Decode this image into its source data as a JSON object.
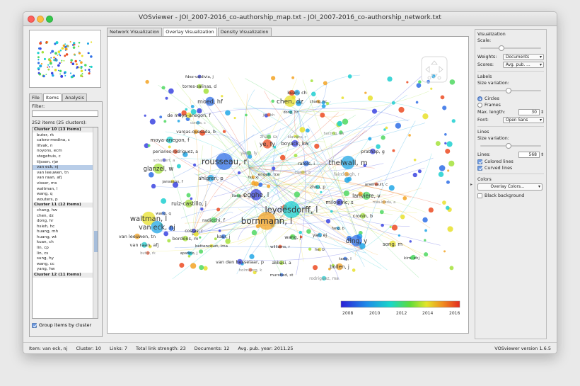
{
  "window": {
    "title": "VOSviewer - JOI_2007-2016_co-authorship_map.txt - JOI_2007-2016_co-authorship_network.txt"
  },
  "left": {
    "tabs": [
      "File",
      "Items",
      "Analysis"
    ],
    "filter_label": "Filter:",
    "items_count": "252 items (25 clusters):",
    "list": [
      {
        "text": "Cluster 10 (13 items)",
        "header": true
      },
      {
        "text": "buter, rk"
      },
      {
        "text": "calero-medina, c"
      },
      {
        "text": "litvak, n"
      },
      {
        "text": "noyons, ecm"
      },
      {
        "text": "stegehuis, c"
      },
      {
        "text": "tijssen, rjw"
      },
      {
        "text": "van eck, nj",
        "selected": true
      },
      {
        "text": "van leeuwen, tn"
      },
      {
        "text": "van raan, afj"
      },
      {
        "text": "visser, ms"
      },
      {
        "text": "waltman, l"
      },
      {
        "text": "wang, q"
      },
      {
        "text": "wouters, p"
      },
      {
        "text": "Cluster 11 (12 items)",
        "header": true
      },
      {
        "text": "chang, hw"
      },
      {
        "text": "chen, dz"
      },
      {
        "text": "dong, hr"
      },
      {
        "text": "hsieh, hc"
      },
      {
        "text": "huang, mh"
      },
      {
        "text": "huang, wt"
      },
      {
        "text": "kuan, ch"
      },
      {
        "text": "lin, cp"
      },
      {
        "text": "lin, cs"
      },
      {
        "text": "sung, hy"
      },
      {
        "text": "wang, cc"
      },
      {
        "text": "yang, hw"
      },
      {
        "text": "Cluster 12 (11 items)",
        "header": true
      }
    ],
    "group_label": "Group items by cluster"
  },
  "center": {
    "tabs": [
      "Network Visualization",
      "Overlay Visualization",
      "Density Visualization"
    ],
    "legend": {
      "ticks": [
        "2008",
        "2010",
        "2012",
        "2014",
        "2016"
      ]
    },
    "labels": [
      {
        "t": "fdez-valdivia, j",
        "s": 5.5,
        "c": "#333"
      },
      {
        "t": "torres-salinas, d",
        "s": 6,
        "c": "#333"
      },
      {
        "t": "moed, hf",
        "s": 8,
        "c": "#333"
      },
      {
        "t": "de moya-anegon, f",
        "s": 6.5,
        "c": "#333"
      },
      {
        "t": "corera, c",
        "s": 5,
        "c": "#888"
      },
      {
        "t": "vargas-quesada, b",
        "s": 6,
        "c": "#333"
      },
      {
        "t": "moya-anegon, f",
        "s": 7,
        "c": "#333"
      },
      {
        "t": "perianes-rodriguez, a",
        "s": 6,
        "c": "#333"
      },
      {
        "t": "yang, ly",
        "s": 6,
        "c": "#888"
      },
      {
        "t": "schubert, a",
        "s": 5.5,
        "c": "#888"
      },
      {
        "t": "glanzel, w",
        "s": 8.5,
        "c": "#333"
      },
      {
        "t": "rousseau, r",
        "s": 11.5,
        "c": "#333"
      },
      {
        "t": "janssens, f",
        "s": 5.5,
        "c": "#333"
      },
      {
        "t": "ahlgren, p",
        "s": 7,
        "c": "#333"
      },
      {
        "t": "hu, xj",
        "s": 5.5,
        "c": "#333"
      },
      {
        "t": "engels, tce",
        "s": 5.5,
        "c": "#333"
      },
      {
        "t": "jin, bh",
        "s": 5.5,
        "c": "#888"
      },
      {
        "t": "liang, l",
        "s": 5.5,
        "c": "#333"
      },
      {
        "t": "egghe, l",
        "s": 9,
        "c": "#333"
      },
      {
        "t": "ruiz-castillo, j",
        "s": 7.5,
        "c": "#333"
      },
      {
        "t": "wang, q",
        "s": 5.5,
        "c": "#333"
      },
      {
        "t": "waltman, l",
        "s": 10,
        "c": "#333"
      },
      {
        "t": "van eck, nj",
        "s": 9.5,
        "c": "#333"
      },
      {
        "t": "van leeuwen, tn",
        "s": 6.5,
        "c": "#333"
      },
      {
        "t": "van raan, afj",
        "s": 6.5,
        "c": "#333"
      },
      {
        "t": "buter, rk",
        "s": 5,
        "c": "#888"
      },
      {
        "t": "radicchi, f",
        "s": 6.5,
        "c": "#333"
      },
      {
        "t": "costas, r",
        "s": 6,
        "c": "#333"
      },
      {
        "t": "bordons, m",
        "s": 6.5,
        "c": "#333"
      },
      {
        "t": "kaur, j",
        "s": 6,
        "c": "#333"
      },
      {
        "t": "bettencourt, lma",
        "s": 5.5,
        "c": "#333"
      },
      {
        "t": "aparicio, j",
        "s": 5,
        "c": "#333"
      },
      {
        "t": "bornmann, l",
        "s": 12,
        "c": "#333"
      },
      {
        "t": "leydesdorff, l",
        "s": 11.5,
        "c": "#333"
      },
      {
        "t": "williams, r",
        "s": 5.5,
        "c": "#333"
      },
      {
        "t": "wang, j",
        "s": 6.5,
        "c": "#333"
      },
      {
        "t": "van den besselaar, p",
        "s": 6.5,
        "c": "#333"
      },
      {
        "t": "abbasi, a",
        "s": 6,
        "c": "#333"
      },
      {
        "t": "murshed, st",
        "s": 5.5,
        "c": "#333"
      },
      {
        "t": "chen, dz",
        "s": 9,
        "c": "#333"
      },
      {
        "t": "kuan, ch",
        "s": 6.5,
        "c": "#333"
      },
      {
        "t": "chang, hc",
        "s": 5,
        "c": "#333"
      },
      {
        "t": "dong, hr",
        "s": 5,
        "c": "#333"
      },
      {
        "t": "ye, fy",
        "s": 8,
        "c": "#333"
      },
      {
        "t": "zhao, sx",
        "s": 6,
        "c": "#888"
      },
      {
        "t": "boyack, kw",
        "s": 7,
        "c": "#333"
      },
      {
        "t": "klavans, r",
        "s": 5.5,
        "c": "#888"
      },
      {
        "t": "rafols, i",
        "s": 6.5,
        "c": "#333"
      },
      {
        "t": "ciarelli, p",
        "s": 5,
        "c": "#888"
      },
      {
        "t": "thelwall, m",
        "s": 10,
        "c": "#333"
      },
      {
        "t": "fairclough, r",
        "s": 6,
        "c": "#888"
      },
      {
        "t": "zhou, p",
        "s": 6,
        "c": "#333"
      },
      {
        "t": "arsenault, c",
        "s": 5.5,
        "c": "#333"
      },
      {
        "t": "lariviere, v",
        "s": 7.5,
        "c": "#333"
      },
      {
        "t": "milojevic, s",
        "s": 7,
        "c": "#333"
      },
      {
        "t": "cronin, b",
        "s": 6.5,
        "c": "#333"
      },
      {
        "t": "ding, y",
        "s": 9,
        "c": "#333"
      },
      {
        "t": "song, m",
        "s": 7,
        "c": "#333"
      },
      {
        "t": "yan, ej",
        "s": 6,
        "c": "#333"
      },
      {
        "t": "bollen, j",
        "s": 7,
        "c": "#333"
      },
      {
        "t": "rodriguez, ma",
        "s": 6,
        "c": "#888"
      },
      {
        "t": "holmberg, k",
        "s": 5.5,
        "c": "#888"
      },
      {
        "t": "kim, ehj",
        "s": 5.5,
        "c": "#333"
      },
      {
        "t": "prathap, g",
        "s": 6.5,
        "c": "#333"
      },
      {
        "t": "harzing, aw",
        "s": 5,
        "c": "#888"
      },
      {
        "t": "tang, l",
        "s": 5.5,
        "c": "#333"
      },
      {
        "t": "he, b",
        "s": 5.5,
        "c": "#333"
      },
      {
        "t": "fang, b",
        "s": 5,
        "c": "#333"
      },
      {
        "t": "mas-bleda, a",
        "s": 5,
        "c": "#888"
      }
    ]
  },
  "right": {
    "visualization": "Visualization",
    "scale": "Scale:",
    "weights_label": "Weights:",
    "weights_value": "Documents",
    "scores_label": "Scores:",
    "scores_value": "Avg. pub. ...",
    "labels": "Labels",
    "size_variation": "Size variation:",
    "circles": "Circles",
    "frames": "Frames",
    "max_length_label": "Max. length:",
    "max_length_value": "30",
    "font_label": "Font:",
    "font_value": "Open Sans",
    "lines": "Lines",
    "lines_size_variation": "Size variation:",
    "lines_label": "Lines:",
    "lines_value": "568",
    "colored_lines": "Colored lines",
    "curved_lines": "Curved lines",
    "colors": "Colors",
    "overlay_colors": "Overlay Colors...",
    "black_background": "Black background"
  },
  "status": {
    "item": "Item:  van eck, nj",
    "cluster": "Cluster:  10",
    "links": "Links:  7",
    "tls": "Total link strength:  23",
    "documents": "Documents:  12",
    "avg_year": "Avg. pub. year:  2011.25",
    "version": "VOSviewer version 1.6.5"
  }
}
